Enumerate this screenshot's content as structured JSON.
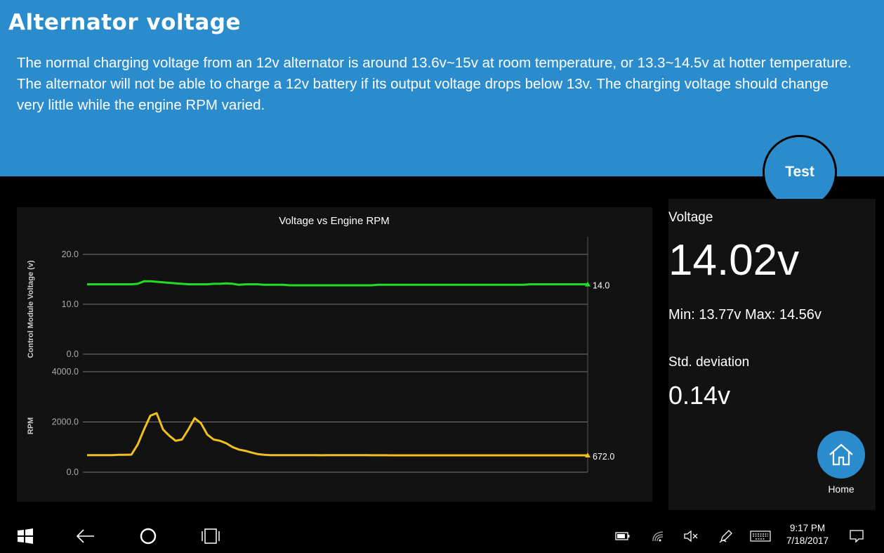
{
  "header": {
    "title": "Alternator  voltage",
    "description": "The normal charging voltage from an 12v alternator is around 13.6v~15v at room temperature, or 13.3~14.5v at hotter temperature. The alternator will not be able to charge a 12v battery if its output voltage drops below 13v. The charging voltage should change very little while the engine RPM varied."
  },
  "test_button": {
    "label": "Test"
  },
  "stats": {
    "voltage_label": "Voltage",
    "voltage_value": "14.02v",
    "min_max": "Min: 13.77v  Max: 14.56v",
    "std_label": "Std. deviation",
    "std_value": "0.14v"
  },
  "home_button": {
    "label": "Home",
    "icon": "home-icon"
  },
  "taskbar": {
    "time": "9:17 PM",
    "date": "7/18/2017",
    "icons": [
      "windows-start-icon",
      "back-icon",
      "cortana-icon",
      "task-view-icon",
      "battery-icon",
      "wifi-icon",
      "volume-muted-icon",
      "pen-icon",
      "keyboard-icon",
      "notifications-icon"
    ]
  },
  "colors": {
    "header": "#2a8ccd",
    "voltage_series": "#22dd22",
    "rpm_series": "#f0c020",
    "panel": "#121212"
  },
  "chart_data": {
    "type": "line",
    "title": "Voltage vs Engine RPM",
    "panels": [
      {
        "ylabel": "Control Module Voltage (v)",
        "ylim": [
          0,
          20
        ],
        "yticks": [
          "20.0",
          "10.0",
          "0.0"
        ],
        "series": [
          {
            "color": "#22dd22",
            "end_label": "14.0",
            "values": [
              14.0,
              14.0,
              14.0,
              14.0,
              14.0,
              14.0,
              14.0,
              14.0,
              14.1,
              14.6,
              14.6,
              14.5,
              14.4,
              14.3,
              14.2,
              14.1,
              14.0,
              14.0,
              14.0,
              14.0,
              14.1,
              14.1,
              14.2,
              14.1,
              13.9,
              14.0,
              14.0,
              14.0,
              13.9,
              13.9,
              13.9,
              13.9,
              13.8,
              13.8,
              13.8,
              13.8,
              13.8,
              13.8,
              13.8,
              13.8,
              13.8,
              13.8,
              13.8,
              13.8,
              13.8,
              13.8,
              13.9,
              13.9,
              13.9,
              13.9,
              13.9,
              13.9,
              13.9,
              13.9,
              13.9,
              13.9,
              13.9,
              13.9,
              13.9,
              13.9,
              13.9,
              13.9,
              13.9,
              13.9,
              13.9,
              13.9,
              13.9,
              13.9,
              13.9,
              13.9,
              14.0,
              14.0,
              14.0,
              14.0,
              14.0,
              14.0,
              14.0,
              14.0,
              14.0,
              14.0
            ]
          }
        ]
      },
      {
        "ylabel": "RPM",
        "ylim": [
          0,
          4000
        ],
        "yticks": [
          "4000.0",
          "2000.0",
          "0.0"
        ],
        "series": [
          {
            "color": "#f0c020",
            "end_label": "672.0",
            "values": [
              680,
              680,
              680,
              680,
              680,
              690,
              690,
              700,
              1100,
              1700,
              2250,
              2350,
              1700,
              1450,
              1250,
              1300,
              1700,
              2150,
              1950,
              1500,
              1300,
              1250,
              1150,
              1000,
              900,
              850,
              780,
              720,
              690,
              680,
              680,
              680,
              680,
              680,
              680,
              680,
              680,
              675,
              680,
              680,
              680,
              680,
              680,
              680,
              680,
              675,
              675,
              675,
              670,
              670,
              670,
              670,
              670,
              672,
              672,
              672,
              672,
              672,
              672,
              672,
              672,
              672,
              672,
              672,
              672,
              672,
              672,
              672,
              672,
              672,
              672,
              672,
              672,
              672,
              672,
              672,
              672,
              672,
              672,
              672
            ]
          }
        ]
      }
    ]
  }
}
